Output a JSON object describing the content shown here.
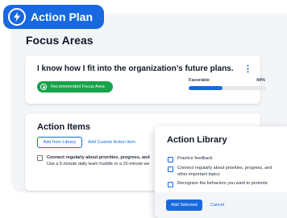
{
  "app": {
    "title": "Action Plan",
    "icon": "lightning-bolt-icon"
  },
  "focus_areas": {
    "heading": "Focus Areas",
    "card": {
      "statement": "I know how I fit into the organization’s future plans.",
      "menu_icon": "kebab-menu-icon",
      "recommended_label": "Recommended Focus Area",
      "favorable_label": "Favorable",
      "favorable_pct_text": "44%",
      "favorable_fraction": 0.44
    }
  },
  "action_items": {
    "heading": "Action Items",
    "add_from_library_label": "Add from Library",
    "add_custom_label": "Add Custom Action Item",
    "item": {
      "title": "Connect regularly about priorities, progress, and",
      "subtitle": "Use a 5-minute daily team huddle or a 15-minute we"
    }
  },
  "action_library": {
    "title": "Action Library",
    "items": [
      "Practice feedback",
      "Connect regularly about priorities, progress, and other important topics",
      "Recognize the behaviors you want to promote"
    ],
    "add_selected_label": "Add Selected",
    "cancel_label": "Cancel"
  },
  "colors": {
    "brand_blue": "#1769e0",
    "recommended_green": "#17a34a",
    "panel_bg": "#f3f5f8"
  }
}
